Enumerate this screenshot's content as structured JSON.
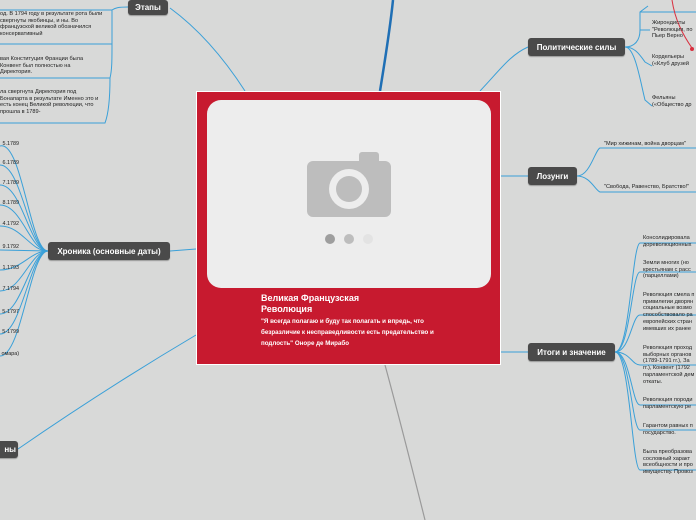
{
  "central": {
    "title": "Великая Французская Революция",
    "quote": "\"Я всегда полагаю и буду так полагать и впредь, что безразличие к несправедливости есть предательство и подлость\" Оноре де Мирабо"
  },
  "branches": {
    "stages": "Этапы",
    "political": "Политические силы",
    "slogans": "Лозунги",
    "chronicle": "Хроника (основные даты)",
    "results": "Итоги и значение",
    "causes": "ны"
  },
  "stages_leaves": [
    "од. В 1794 году в результате рота были свергнуты якобинцы, и ны. Во французской великой обозначился консервативный",
    "вая Конституция Франции была Конвент был полностью на Директория.",
    "ла свергнута Директория под Бонапарта в результате Именно это и есть конец Великой революции, что прошла в 1789-"
  ],
  "political_leaves": [
    "Жирондисты \"Революция, по Пьер Верно",
    "Кордельеры («Клуб друзей",
    "Фельяны («Общество др"
  ],
  "slogans_leaves": [
    "\"Мир хижинам, война дворцам\"",
    "\"Свобода, Равенство, Братство!\""
  ],
  "chronicle_dates": [
    "5.1789",
    "6.1789",
    "7.1789",
    "8.1789",
    "4.1792",
    "9.1792",
    "1.1793",
    "7.1794",
    "5-1797",
    "5-1799",
    "омара)"
  ],
  "results_leaves": [
    "Консолидировала дореволюционных",
    "Земли многих (но крестьянам с расс (парцеллами)",
    "Революция смела п привилегии дворян социальные возмо способствовало ра европейских стран имевших их ранее",
    "Революция проход выборных органов (1789-1791 гг.), За гг.), Конвент (1792 парламентской дем откаты.",
    "Революция породи парламентскую ре",
    "Гарантом равных п государство.",
    "Была преобразова сословный характ всеобщности и про имуществу. Провоз"
  ],
  "colors": {
    "accent": "#c71a2f",
    "node_bg": "#4a4a4a",
    "line": "#3aa0d8"
  }
}
